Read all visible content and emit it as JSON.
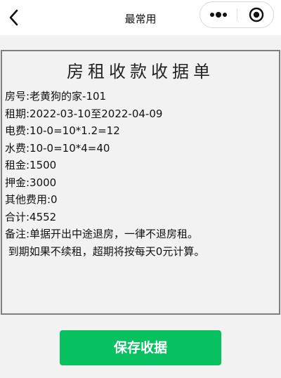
{
  "nav": {
    "title": "最常用"
  },
  "receipt": {
    "title": "房租收款收据单",
    "lines": [
      "房号:老黄狗的家-101",
      "租期:2022-03-10至2022-04-09",
      "电费:10-0=10*1.2=12",
      "水费:10-0=10*4=40",
      "租金:1500",
      "押金:3000",
      "其他费用:0",
      "合计:4552",
      "备注:单据开出中途退房，一律不退房租。",
      " 到期如果不续租，超期将按每天0元计算。"
    ]
  },
  "actions": {
    "save_label": "保存收据"
  },
  "colors": {
    "primary": "#07c160",
    "border": "#7f7f7f",
    "background": "#f2f2f2"
  },
  "icons": {
    "back": "chevron-left",
    "more": "more-dots",
    "close": "target-circle"
  }
}
